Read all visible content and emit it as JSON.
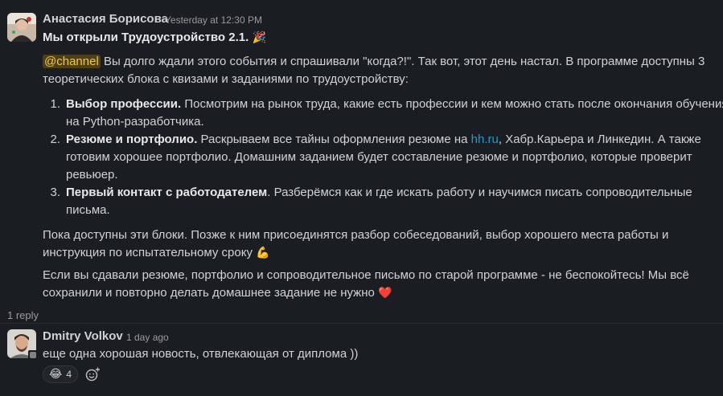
{
  "post": {
    "author": "Анастасия Борисова",
    "timestamp": "Yesterday at 12:30 PM",
    "title": "Мы открыли Трудоустройство 2.1.",
    "title_emoji": "🎉",
    "intro_mention": "@channel",
    "intro_line1": " Вы долго ждали этого события и спрашивали \"когда?!\". Так вот, этот день настал. В программе доступны 3",
    "intro_line2": "теоретических блока с квизами и заданиями по трудоустройству:",
    "list": [
      {
        "num": "1.",
        "bold": "Выбор профессии.",
        "line1_rest": " Посмотрим на рынок труда, какие есть профессии и кем можно стать после окончания обучения",
        "line2": "на Python-разработчика."
      },
      {
        "num": "2.",
        "bold": "Резюме и портфолио.",
        "line1_pre": " Раскрываем все тайны оформления резюме на ",
        "line1_link": "hh.ru",
        "line1_post": ", Хабр.Карьера и Линкедин. А также",
        "line2": "готовим хорошее портфолио. Домашним заданием будет составление резюме и портфолио, которые проверит",
        "line3": "ревьюер."
      },
      {
        "num": "3.",
        "bold": "Первый контакт с работодателем",
        "line1_rest": ". Разберёмся как и где искать работу и научимся писать сопроводительные",
        "line2": "письма."
      }
    ],
    "para2_line1": "Пока доступны эти блоки. Позже к ним присоединятся разбор собеседований, выбор хорошего места работы и",
    "para2_line2": "инструкция по испытательному сроку",
    "para2_emoji": "💪",
    "para3_line1": "Если вы сдавали резюме, портфолио и сопроводительное письмо по старой программе - не беспокойтесь! Мы всё",
    "para3_line2": "сохранили и повторно делать домашнее задание не нужно",
    "para3_emoji": "❤️"
  },
  "thread": {
    "reply_count": "1 reply"
  },
  "reply": {
    "author": "Dmitry Volkov",
    "timestamp": "1 day ago",
    "text": "еще одна хорошая новость, отвлекающая от диплома ))",
    "reaction_emoji": "😂",
    "reaction_count": "4"
  },
  "icons": {
    "add_reaction": "add-reaction-icon"
  },
  "colors": {
    "background": "#1a1d21",
    "text": "#d1d2d3",
    "muted": "#9a9b9d",
    "link": "#1d9bd1",
    "mention_bg": "#4f3f16",
    "mention_fg": "#f2c744"
  }
}
